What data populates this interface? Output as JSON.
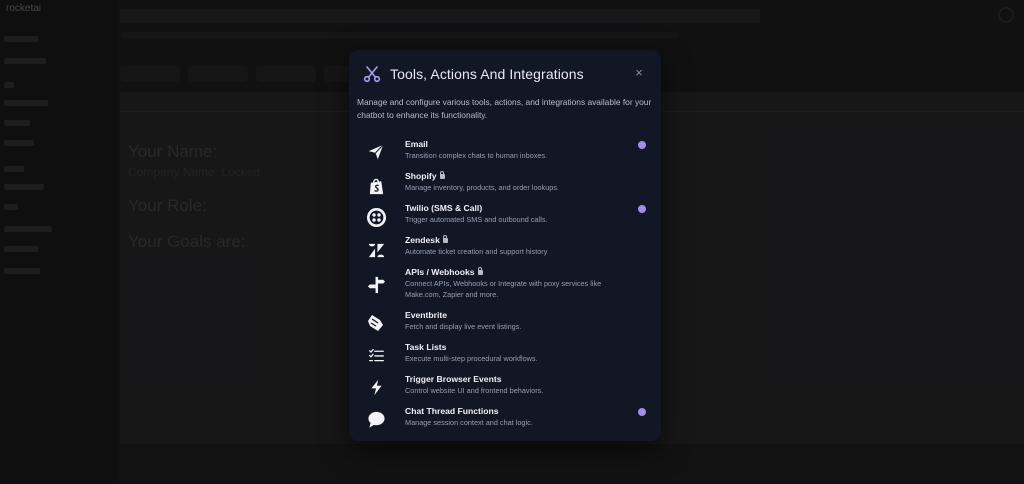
{
  "app": {
    "brand": "rocketai",
    "editor_lines": [
      "Your Name:",
      "Company Name: Locked",
      "Your Role:",
      "Your Goals are:"
    ]
  },
  "modal": {
    "title": "Tools, Actions And Integrations",
    "close_label": "×",
    "description": "Manage and configure various tools, actions, and integrations available for your chatbot to enhance its functionality.",
    "accent_color": "#a08ee8",
    "tools": [
      {
        "name": "Email",
        "description": "Transition complex chats to human inboxes.",
        "icon": "send-icon",
        "locked": false,
        "enabled": true
      },
      {
        "name": "Shopify",
        "description": "Manage inventory, products, and order lookups.",
        "icon": "shopify-icon",
        "locked": true,
        "enabled": false
      },
      {
        "name": "Twilio (SMS & Call)",
        "description": "Trigger automated SMS and outbound calls.",
        "icon": "twilio-icon",
        "locked": false,
        "enabled": true
      },
      {
        "name": "Zendesk",
        "description": "Automate ticket creation and support history",
        "icon": "zendesk-icon",
        "locked": true,
        "enabled": false
      },
      {
        "name": "APIs / Webhooks",
        "description": "Connect APIs, Webhooks or Integrate with poxy services like Make.com, Zapier and more.",
        "icon": "api-signpost-icon",
        "locked": true,
        "enabled": false
      },
      {
        "name": "Eventbrite",
        "description": "Fetch and display live event listings.",
        "icon": "eventbrite-icon",
        "locked": false,
        "enabled": false
      },
      {
        "name": "Task Lists",
        "description": "Execute multi-step procedural workflows.",
        "icon": "task-list-icon",
        "locked": false,
        "enabled": false
      },
      {
        "name": "Trigger Browser Events",
        "description": "Control website UI and frontend behaviors.",
        "icon": "lightning-icon",
        "locked": false,
        "enabled": false
      },
      {
        "name": "Chat Thread Functions",
        "description": "Manage session context and chat logic.",
        "icon": "chat-bubble-icon",
        "locked": false,
        "enabled": true
      }
    ]
  }
}
